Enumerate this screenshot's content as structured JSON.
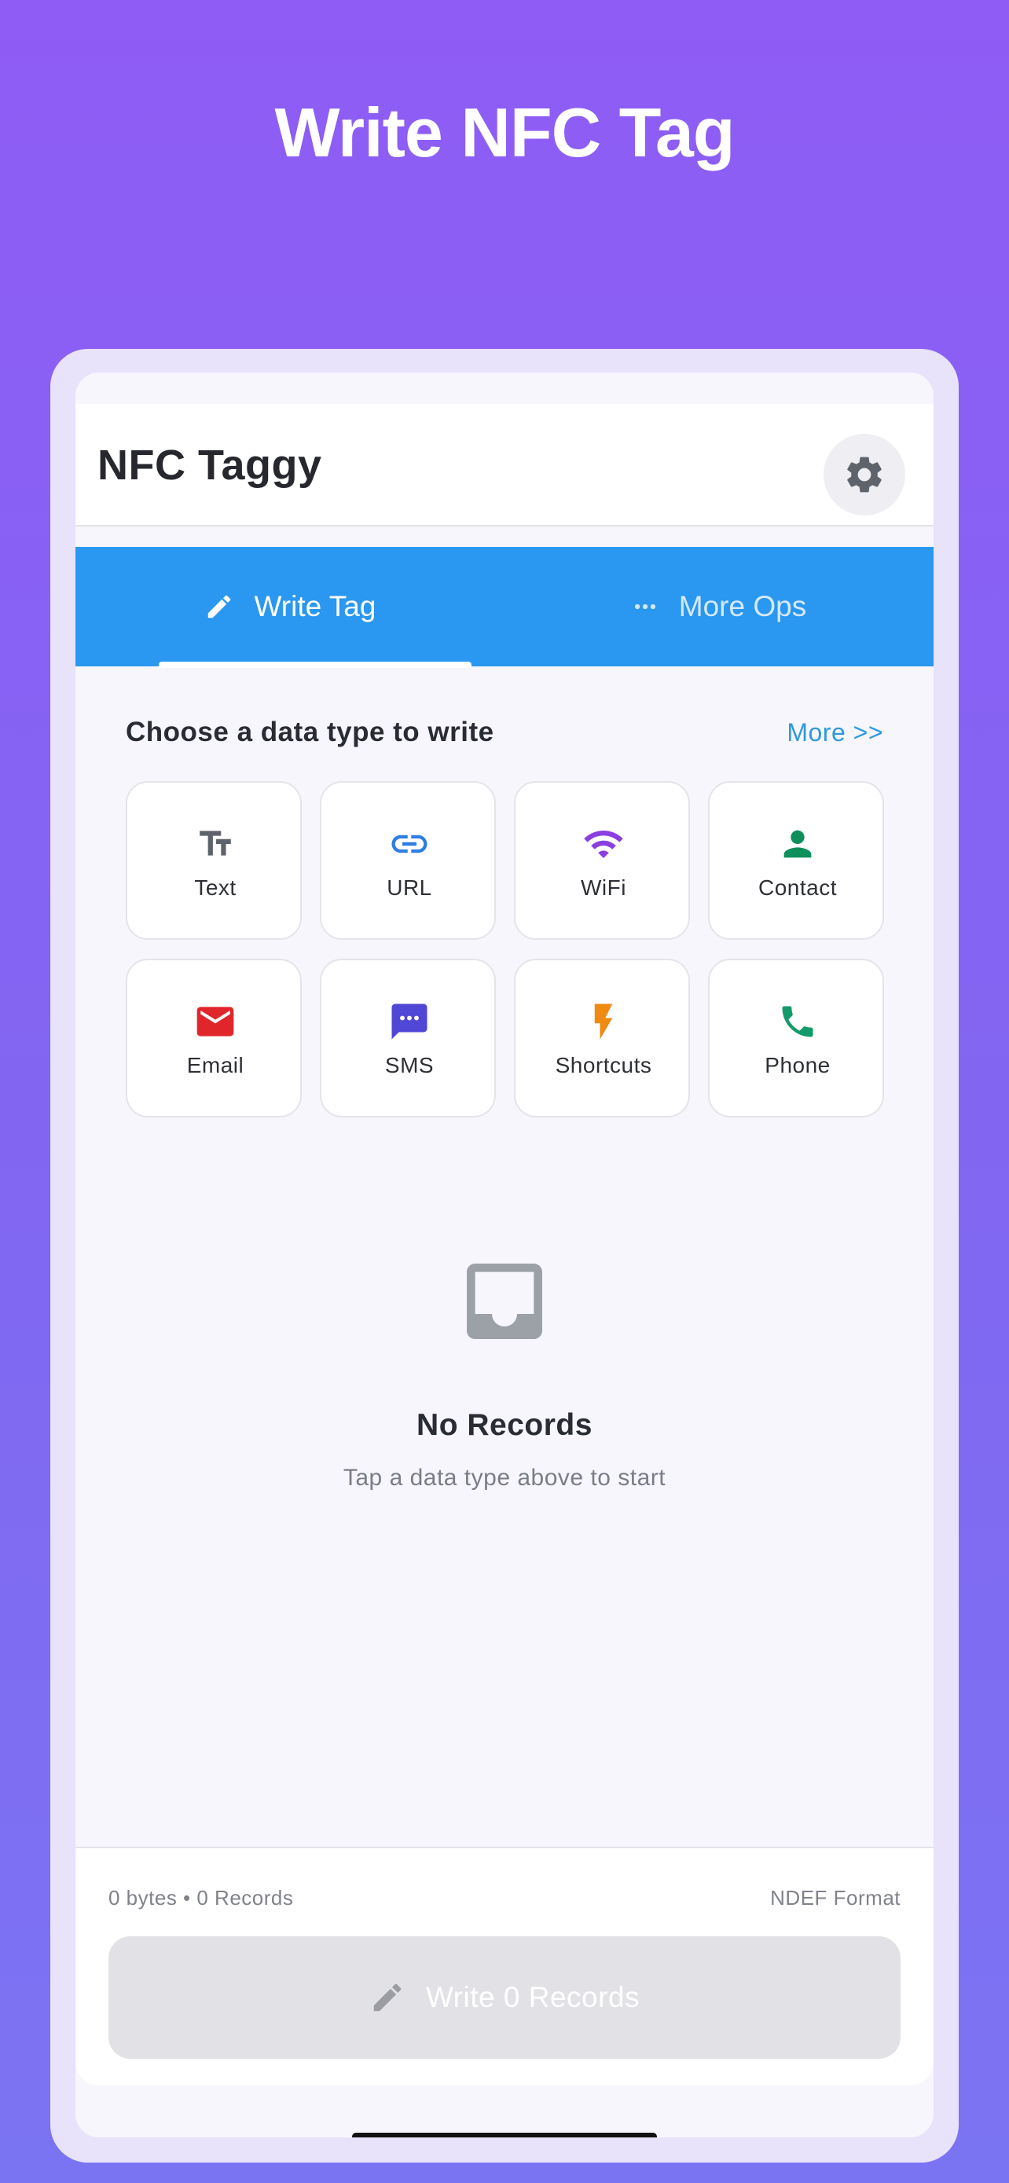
{
  "promo": {
    "title": "Write NFC Tag"
  },
  "app": {
    "title": "NFC Taggy",
    "settings_icon": "gear-icon"
  },
  "tabs": [
    {
      "label": "Write Tag",
      "icon": "pencil-icon",
      "active": true
    },
    {
      "label": "More Ops",
      "icon": "more-dots-icon",
      "active": false
    }
  ],
  "section": {
    "title": "Choose a data type to write",
    "more_link": "More >>"
  },
  "data_types": [
    {
      "label": "Text",
      "icon": "text-icon",
      "color": "#5f636b"
    },
    {
      "label": "URL",
      "icon": "link-icon",
      "color": "#2f7de1"
    },
    {
      "label": "WiFi",
      "icon": "wifi-icon",
      "color": "#8b3fe0"
    },
    {
      "label": "Contact",
      "icon": "person-icon",
      "color": "#0f8f5b"
    },
    {
      "label": "Email",
      "icon": "mail-icon",
      "color": "#e0262b"
    },
    {
      "label": "SMS",
      "icon": "message-icon",
      "color": "#5047d6"
    },
    {
      "label": "Shortcuts",
      "icon": "bolt-icon",
      "color": "#ef8a12"
    },
    {
      "label": "Phone",
      "icon": "phone-icon",
      "color": "#149a6a"
    }
  ],
  "empty_state": {
    "icon": "inbox-icon",
    "title": "No Records",
    "subtitle": "Tap a data type above to start"
  },
  "footer": {
    "stats": "0 bytes • 0 Records",
    "format": "NDEF Format",
    "write_button": "Write 0 Records",
    "write_icon": "pencil-icon"
  },
  "colors": {
    "accent": "#2a97f0",
    "link": "#2f98de",
    "background_gradient_top": "#8f5cf5",
    "background_gradient_bottom": "#7b74f2"
  }
}
